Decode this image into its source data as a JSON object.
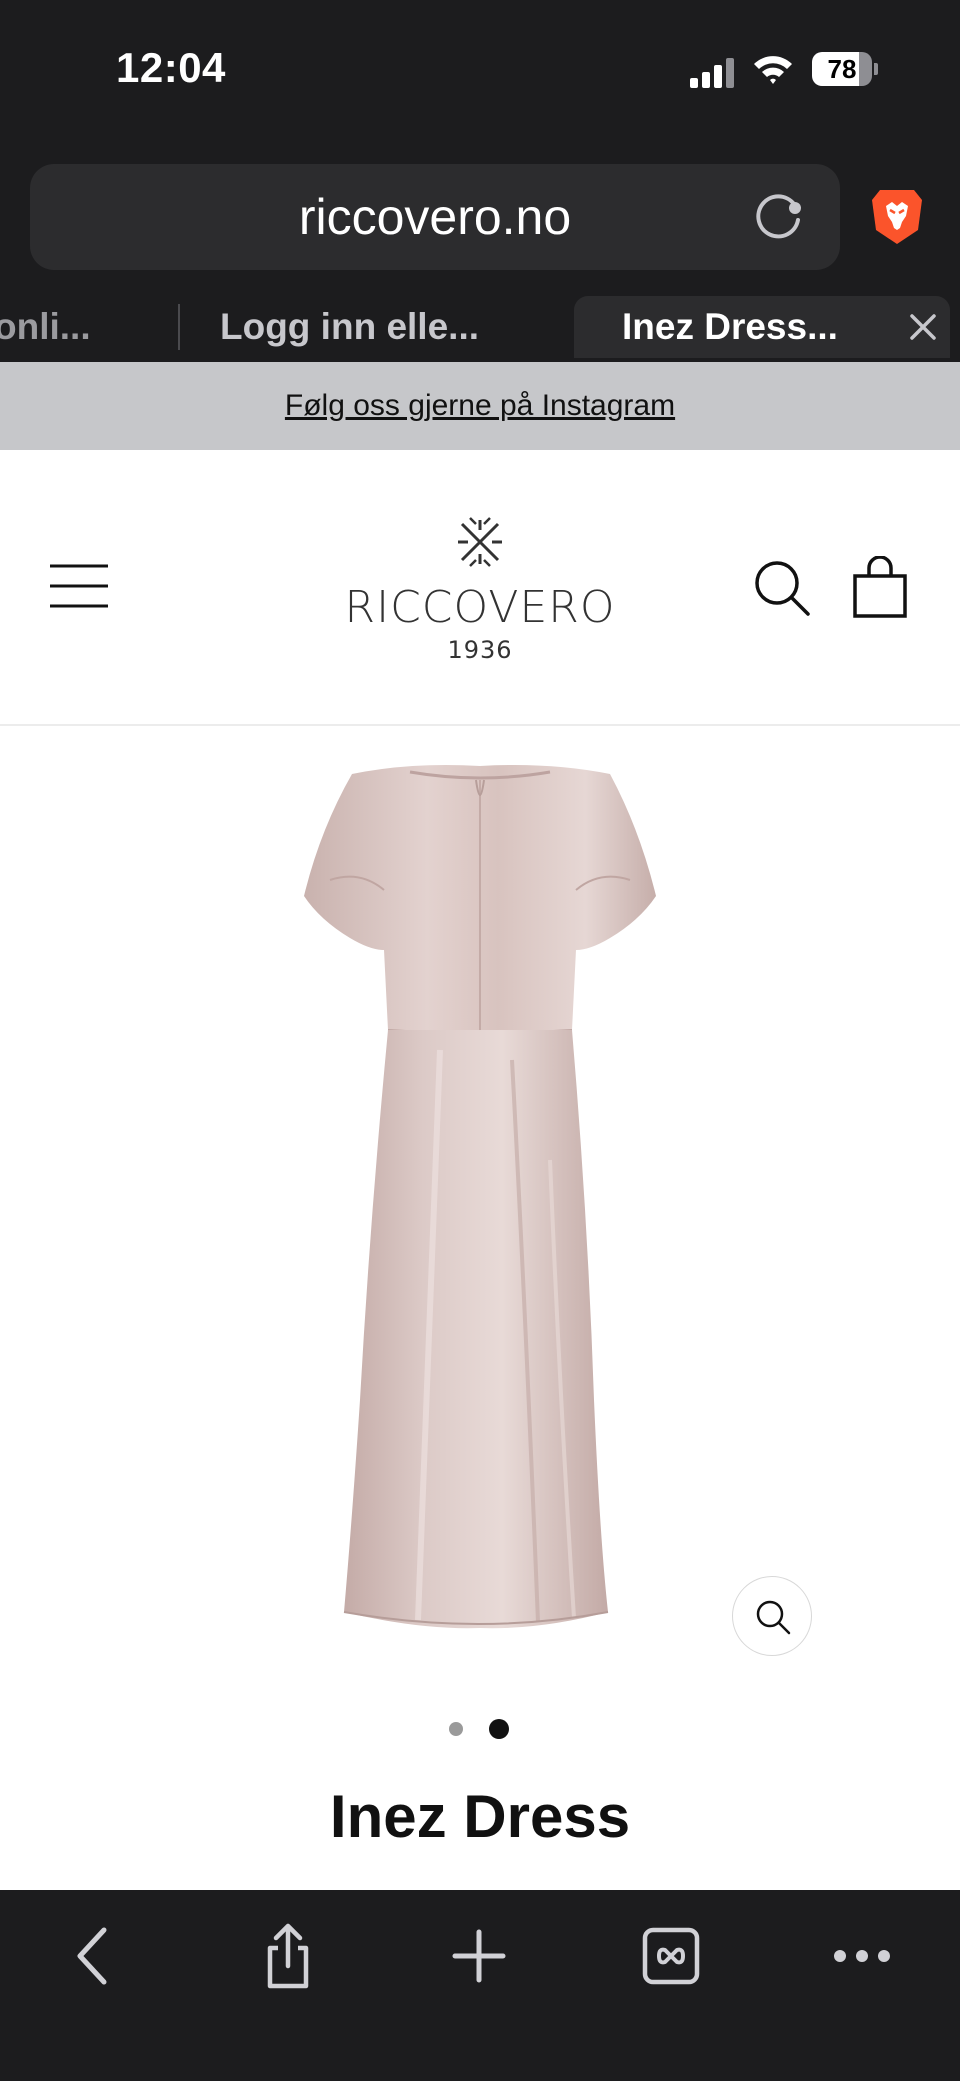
{
  "status_bar": {
    "time": "12:04",
    "battery": "78",
    "battery_level": 0.78
  },
  "browser": {
    "url": "riccovero.no",
    "tabs": [
      {
        "label": "onli..."
      },
      {
        "label": "Logg inn elle..."
      },
      {
        "label": "Inez Dress..."
      }
    ]
  },
  "site": {
    "announcement": "Følg oss gjerne på Instagram",
    "logo_name": "RICCOVERO",
    "logo_year": "1936"
  },
  "product": {
    "title": "Inez Dress",
    "image_count": 2,
    "active_image": 2
  },
  "icons": {
    "menu": "hamburger-menu-icon",
    "search": "search-icon",
    "cart": "shopping-bag-icon",
    "zoom": "zoom-icon",
    "back": "chevron-left-icon",
    "share": "share-icon",
    "new_tab": "plus-icon",
    "tabs": "tabs-icon",
    "more": "more-icon"
  },
  "colors": {
    "chrome": "#1c1c1e",
    "announcement_bg": "#c6c7ca",
    "dress": "#d6c0bd",
    "brave": "#fb542b"
  }
}
